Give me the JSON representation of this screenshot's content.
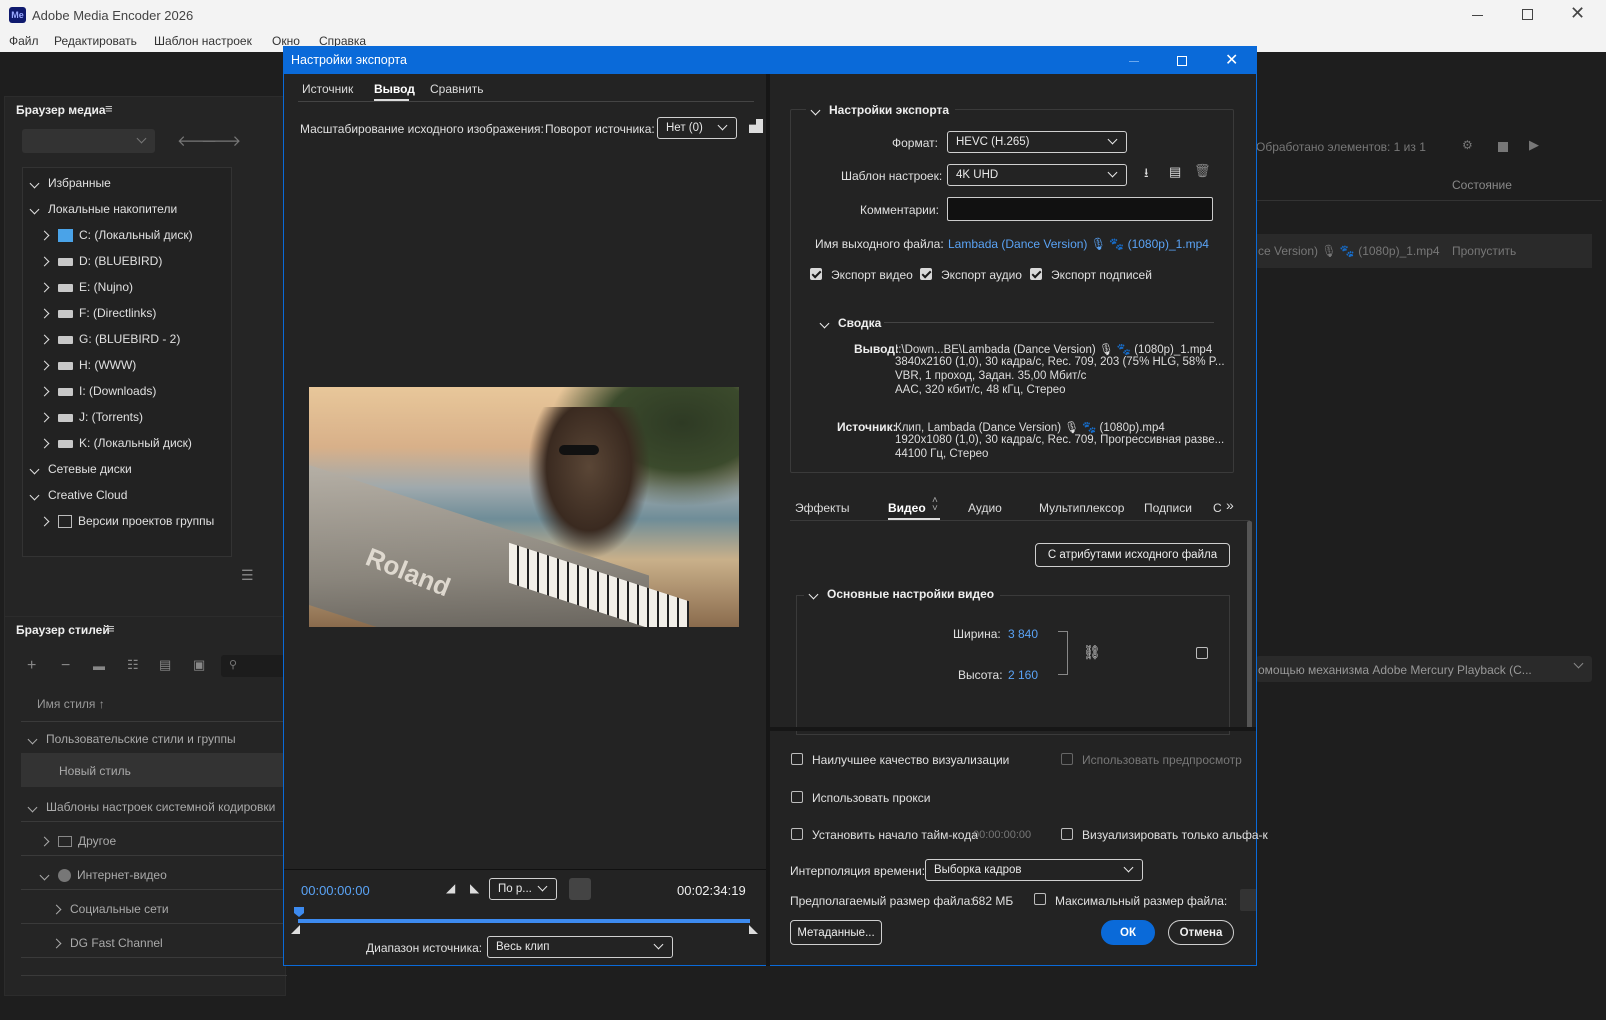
{
  "app": {
    "title": "Adobe Media Encoder 2026",
    "logo": "Me",
    "menu": [
      "Файл",
      "Редактировать",
      "Шаблон настроек",
      "Окно",
      "Справка"
    ]
  },
  "media_browser": {
    "title": "Браузер медиа",
    "favorites": "Избранные",
    "local": "Локальные накопители",
    "drives": [
      "C: (Локальный диск)",
      "D: (BLUEBIRD)",
      "E: (Nujno)",
      "F: (Directlinks)",
      "G: (BLUEBIRD - 2)",
      "H: (WWW)",
      "I: (Downloads)",
      "J: (Torrents)",
      "K: (Локальный диск)"
    ],
    "network": "Сетевые диски",
    "cloud": "Creative Cloud",
    "team": "Версии проектов группы"
  },
  "style_browser": {
    "title": "Браузер стилей",
    "column": "Имя стиля",
    "user_group": "Пользовательские стили и группы",
    "new_style": "Новый стиль",
    "system": "Шаблоны настроек системной кодировки",
    "other": "Другое",
    "web": "Интернет-видео",
    "social": "Социальные сети",
    "dg": "DG Fast Channel"
  },
  "queue": {
    "processed": "Обработано элементов: 1 из 1",
    "status_col": "Состояние",
    "item_name": "ce Version) 🎙 🐾 (1080p)_1.mp4",
    "item_status": "Пропустить",
    "renderer": "омощью механизма Adobe Mercury Playback (C..."
  },
  "dialog": {
    "title": "Настройки экспорта",
    "tabs": [
      "Источник",
      "Вывод",
      "Сравнить"
    ],
    "scale_label": "Масштабирование исходного изображения:",
    "rotate_label": "Поворот источника:",
    "rotate_value": "Нет (0)",
    "timecode_start": "00:00:00:00",
    "timecode_end": "00:02:34:19",
    "fit_value": "По р...",
    "range_label": "Диапазон источника:",
    "range_value": "Весь клип",
    "export_settings": "Настройки экспорта",
    "format_label": "Формат:",
    "format_value": "HEVC (H.265)",
    "preset_label": "Шаблон настроек:",
    "preset_value": "4K UHD",
    "comment_label": "Комментарии:",
    "output_label": "Имя выходного файла:",
    "output_value": "Lambada (Dance Version) 🎙 🐾 (1080p)_1.mp4",
    "export_video": "Экспорт видео",
    "export_audio": "Экспорт аудио",
    "export_captions": "Экспорт подписей",
    "summary": "Сводка",
    "summary_output_label": "Вывод:",
    "summary_output": [
      "I:\\Down...BE\\Lambada (Dance Version) 🎙 🐾 (1080p)_1.mp4",
      "3840x2160 (1,0), 30 кадра/с, Rec. 709, 203 (75% HLG, 58% P...",
      "VBR, 1 проход, Задан. 35,00 Мбит/с",
      "AAC, 320 кбит/с, 48 кГц, Стерео"
    ],
    "summary_source_label": "Источник:",
    "summary_source": [
      "Клип, Lambada (Dance Version) 🎙 🐾 (1080p).mp4",
      "1920x1080 (1,0), 30 кадра/с, Rec. 709, Прогрессивная разве...",
      "44100 Гц, Стерео"
    ],
    "settings_tabs": [
      "Эффекты",
      "Видео",
      "Аудио",
      "Мультиплексор",
      "Подписи",
      "С"
    ],
    "match_source": "С атрибутами исходного файла",
    "basic_video": "Основные настройки видео",
    "width_label": "Ширина:",
    "width_value": "3 840",
    "height_label": "Высота:",
    "height_value": "2 160",
    "best_quality": "Наилучшее качество визуализации",
    "use_preview": "Использовать предпросмотр",
    "use_proxy": "Использовать прокси",
    "set_timecode": "Установить начало тайм-кода",
    "timecode_value": "00:00:00:00",
    "alpha_only": "Визуализировать только альфа-к",
    "interp_label": "Интерполяция времени:",
    "interp_value": "Выборка кадров",
    "size_label": "Предполагаемый размер файла:",
    "size_value": "682 МБ",
    "max_size": "Максимальный размер файла:",
    "metadata": "Метаданные...",
    "ok": "ОК",
    "cancel": "Отмена"
  },
  "colors": {
    "accent": "#0a6ad9",
    "link": "#5aa3f5",
    "dialog_bg": "#232323"
  },
  "preview_image_text": "Roland"
}
